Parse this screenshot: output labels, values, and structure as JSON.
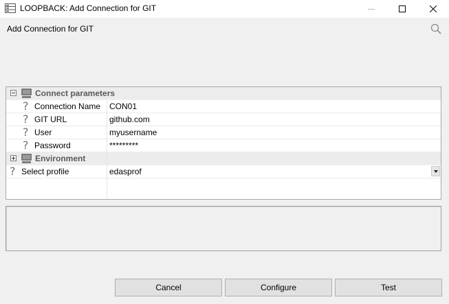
{
  "window": {
    "title": "LOOPBACK: Add Connection for GIT",
    "icons": {
      "app": "server-icon",
      "minimize": "minimize-icon",
      "maximize": "maximize-icon",
      "close": "close-icon"
    }
  },
  "header": {
    "subtitle": "Add Connection for GIT",
    "search_icon": "search-icon"
  },
  "property_grid": {
    "groups": [
      {
        "label": "Connect parameters",
        "state": "expanded",
        "properties": [
          {
            "label": "Connection Name",
            "value": "CON01"
          },
          {
            "label": "GIT URL",
            "value": "github.com"
          },
          {
            "label": "User",
            "value": "myusername"
          },
          {
            "label": "Password",
            "value": "*********"
          }
        ]
      },
      {
        "label": "Environment",
        "state": "collapsed",
        "properties": []
      }
    ],
    "top_level_properties": [
      {
        "label": "Select profile",
        "value": "edasprof",
        "control": "dropdown"
      }
    ],
    "help_icon": "question-icon"
  },
  "buttons": {
    "cancel": "Cancel",
    "configure": "Configure",
    "test": "Test"
  }
}
